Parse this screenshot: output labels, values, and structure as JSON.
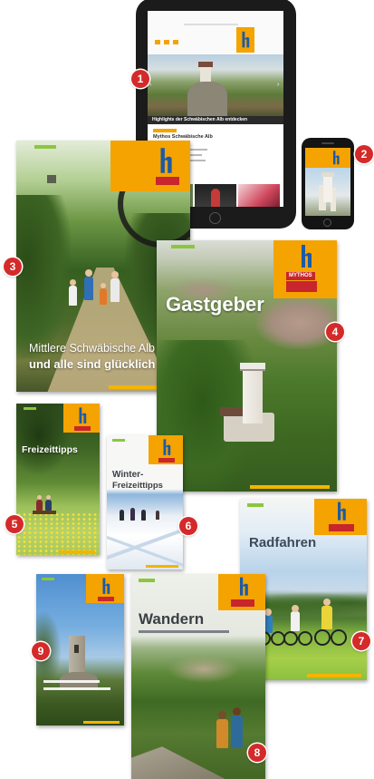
{
  "badges": {
    "b1": "1",
    "b2": "2",
    "b3": "3",
    "b4": "4",
    "b5": "5",
    "b6": "6",
    "b7": "7",
    "b8": "8",
    "b9": "9"
  },
  "tablet": {
    "caption": "Highlights der Schwäbischen Alb entdecken",
    "article_title": "Mythos Schwäbische Alb"
  },
  "brochures": {
    "b3": {
      "subtitle": "Mittlere Schwäbische Alb",
      "tagline": "und alle sind glücklich"
    },
    "b4": {
      "title": "Gastgeber"
    },
    "b5": {
      "title": "Freizeittipps"
    },
    "b6": {
      "title_line1": "Winter-",
      "title_line2": "Freizeittipps"
    },
    "b7": {
      "title": "Radfahren"
    },
    "b8": {
      "title": "Wandern"
    }
  },
  "logo": {
    "wordmark": "MYTHOS",
    "icon": "mythos-alb-logo-icon"
  },
  "colors": {
    "brand_orange": "#f4a300",
    "logo_blue": "#1c5aa6",
    "logo_red": "#c8252c",
    "badge_red": "#d42a2a"
  }
}
